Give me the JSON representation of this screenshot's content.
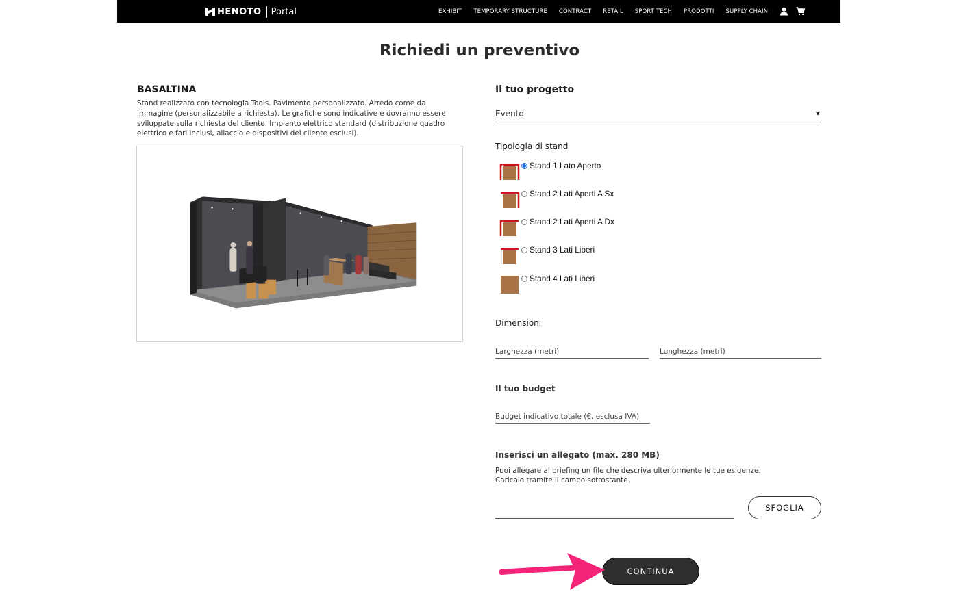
{
  "navbar": {
    "brand": "HENOTO",
    "portal": "Portal",
    "menu": [
      {
        "label": "EXHIBIT"
      },
      {
        "label": "TEMPORARY STRUCTURE"
      },
      {
        "label": "CONTRACT"
      },
      {
        "label": "RETAIL"
      },
      {
        "label": "SPORT TECH"
      },
      {
        "label": "PRODOTTI"
      },
      {
        "label": "SUPPLY CHAIN"
      }
    ],
    "icons": {
      "user": "user-icon",
      "cart": "cart-icon"
    }
  },
  "page": {
    "title": "Richiedi un preventivo"
  },
  "product": {
    "name": "BASALTINA",
    "description": "Stand realizzato con tecnologia Tools. Pavimento personalizzato. Arredo come da immagine (personalizzabile a richiesta). Le grafiche sono indicative e dovranno essere sviluppate sulla richiesta del cliente. Impianto elettrico standard (distribuzione quadro elettrico e fari inclusi, allaccio e dispositivi del cliente esclusi)."
  },
  "form": {
    "project": {
      "heading": "Il tuo progetto",
      "selected": "Evento"
    },
    "stand_type": {
      "heading": "Tipologia di stand",
      "options": [
        {
          "label": "Stand 1 Lato Aperto",
          "checked": true
        },
        {
          "label": "Stand 2 Lati Aperti A Sx",
          "checked": false
        },
        {
          "label": "Stand 2 Lati Aperti A Dx",
          "checked": false
        },
        {
          "label": "Stand 3 Lati Liberi",
          "checked": false
        },
        {
          "label": "Stand 4 Lati Liberi",
          "checked": false
        }
      ]
    },
    "dimensions": {
      "heading": "Dimensioni",
      "width_placeholder": "Larghezza (metri)",
      "length_placeholder": "Lunghezza (metri)"
    },
    "budget": {
      "heading": "Il tuo budget",
      "placeholder": "Budget indicativo totale (€, esclusa IVA)"
    },
    "attachment": {
      "heading": "Inserisci un allegato (max. 280 MB)",
      "line1": "Puoi allegare al briefing un file che descriva ulteriormente le tue esigenze.",
      "line2": "Caricalo tramite il campo sottostante.",
      "browse_label": "SFOGLIA"
    },
    "continue_label": "CONTINUA"
  },
  "colors": {
    "navbar_bg": "#000000",
    "stand_wall": "#d0141b",
    "stand_floor": "#a97445",
    "radio_accent": "#0a66e8",
    "annotation_arrow": "#f5247a",
    "button_dark": "#2f2f2f"
  }
}
